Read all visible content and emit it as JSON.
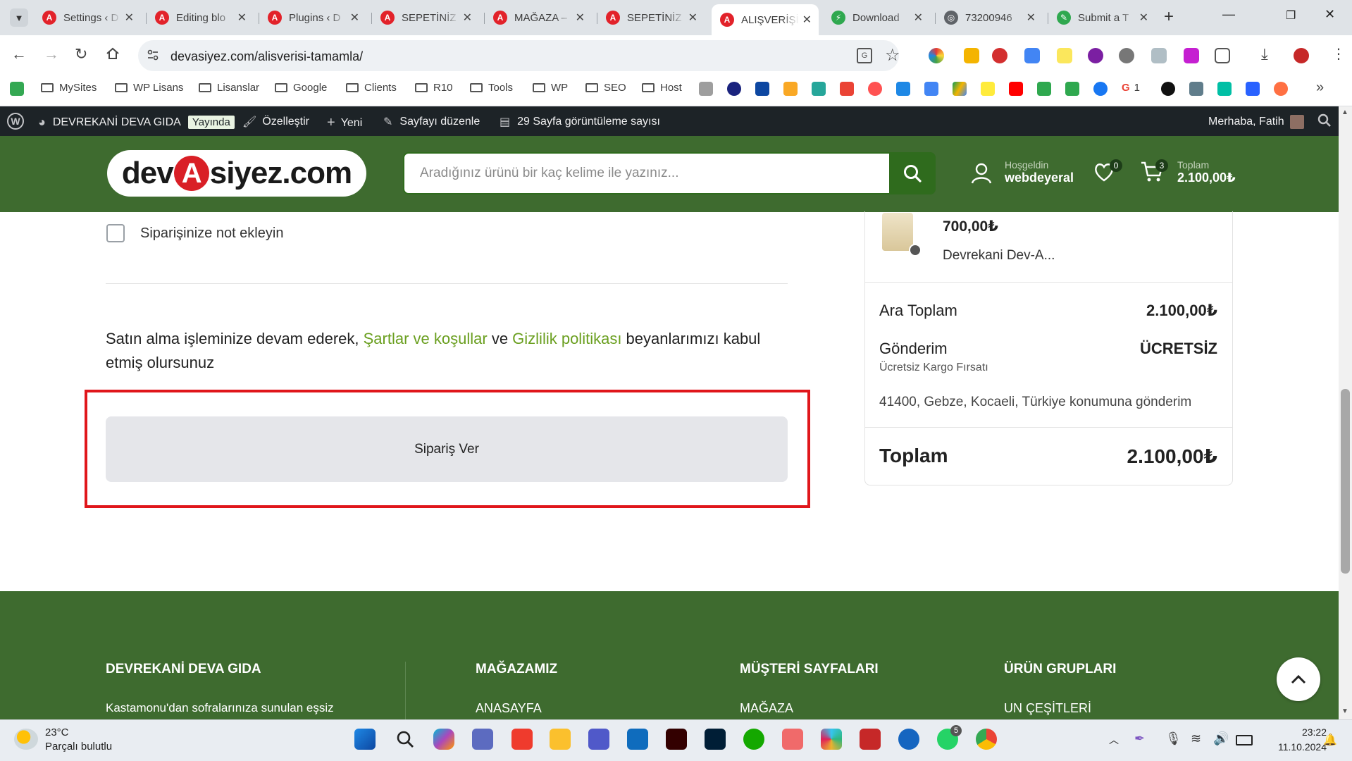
{
  "browser": {
    "tabs": [
      {
        "title": "Settings ‹ D",
        "favicon": "red-a-icon"
      },
      {
        "title": "Editing blo",
        "favicon": "red-a-icon"
      },
      {
        "title": "Plugins ‹ D",
        "favicon": "red-a-icon"
      },
      {
        "title": "SEPETİNİZ",
        "favicon": "red-a-icon"
      },
      {
        "title": "MAĞAZA –",
        "favicon": "red-a-icon"
      },
      {
        "title": "SEPETİNİZ",
        "favicon": "red-a-icon"
      },
      {
        "title": "ALIŞVERİŞİ",
        "favicon": "red-a-icon",
        "active": true
      },
      {
        "title": "Download",
        "favicon": "green-lightning-icon"
      },
      {
        "title": "73200946",
        "favicon": "globe-icon"
      },
      {
        "title": "Submit a T",
        "favicon": "green-pen-icon"
      }
    ],
    "url": "devasiyez.com/alisverisi-tamamla/",
    "bookmarks": {
      "folders": [
        "MySites",
        "WP Lisans",
        "Lisanslar",
        "Google",
        "Clients",
        "R10",
        "Tools",
        "WP",
        "SEO",
        "Host"
      ],
      "google_count": "1"
    }
  },
  "wp_admin_bar": {
    "site_name": "DEVREKANİ DEVA GIDA",
    "status_badge": "Yayında",
    "customize": "Özelleştir",
    "new": "Yeni",
    "edit_page": "Sayfayı düzenle",
    "page_views": "29 Sayfa görüntüleme sayısı",
    "greeting": "Merhaba, Fatih"
  },
  "site_header": {
    "logo_text_pre": "dev",
    "logo_text_a": "A",
    "logo_text_post": "siyez.com",
    "search_placeholder": "Aradığınız ürünü bir kaç kelime ile yazınız...",
    "welcome": "Hoşgeldin",
    "username": "webdeyeral",
    "wishlist_count": "0",
    "cart_count": "3",
    "total_label": "Toplam",
    "total_value": "2.100,00₺",
    "accent_color": "#3e6b2f"
  },
  "checkout": {
    "add_note_label": "Siparişinize not ekleyin",
    "terms_pre": "Satın alma işleminize devam ederek, ",
    "terms_link1": "Şartlar ve koşullar",
    "terms_mid": " ve ",
    "terms_link2": "Gizlilik politikası",
    "terms_post": " beyanlarımızı kabul etmiş olursunuz",
    "place_order_label": "Sipariş Ver"
  },
  "order_summary": {
    "product_price": "700,00₺",
    "product_name": "Devrekani Dev-A...",
    "subtotal_label": "Ara Toplam",
    "subtotal_value": "2.100,00₺",
    "shipping_label": "Gönderim",
    "shipping_value": "ÜCRETSİZ",
    "shipping_note": "Ücretsiz Kargo Fırsatı",
    "address": "41400, Gebze, Kocaeli, Türkiye konumuna gönderim",
    "total_label": "Toplam",
    "total_value": "2.100,00₺"
  },
  "footer": {
    "columns": [
      {
        "title": "DEVREKANİ DEVA GIDA",
        "text": "Kastamonu'dan sofralarınıza sunulan eşsiz"
      },
      {
        "title": "MAĞAZAMIZ",
        "text": "ANASAYFA"
      },
      {
        "title": "MÜŞTERİ SAYFALARI",
        "text": "MAĞAZA"
      },
      {
        "title": "ÜRÜN GRUPLARI",
        "text": "UN ÇEŞİTLERİ"
      }
    ]
  },
  "taskbar": {
    "temperature": "23°C",
    "weather": "Parçalı bulutlu",
    "time": "23:22",
    "date": "11.10.2024",
    "whatsapp_badge": "5"
  }
}
